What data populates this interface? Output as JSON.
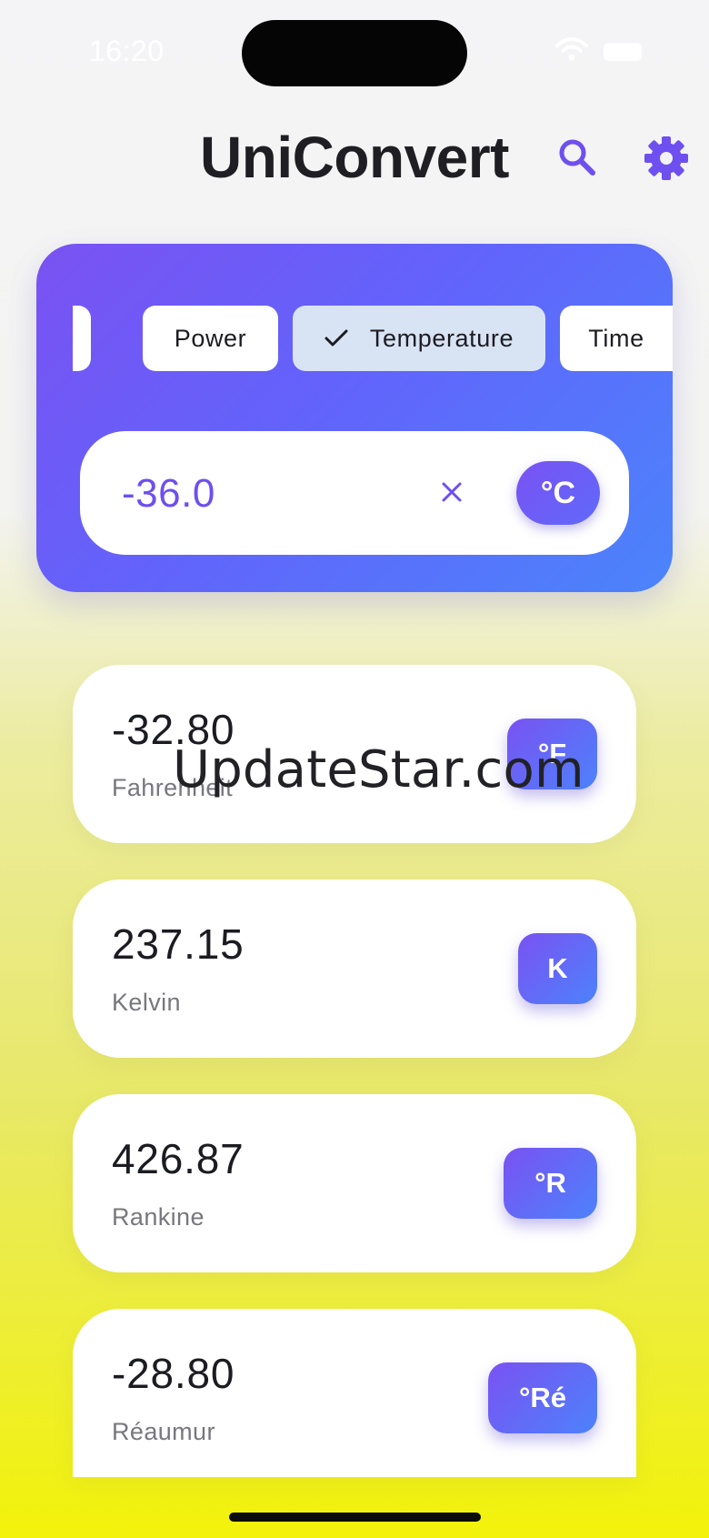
{
  "status_bar": {
    "time": "16:20"
  },
  "header": {
    "title": "UniConvert",
    "search_icon": "search-icon",
    "settings_icon": "gear-icon"
  },
  "categories": {
    "items": [
      {
        "label": "Power",
        "selected": false
      },
      {
        "label": "Temperature",
        "selected": true
      },
      {
        "label": "Time",
        "selected": false
      }
    ]
  },
  "input": {
    "value": "-36.0",
    "unit": "°C"
  },
  "results": [
    {
      "value": "-32.80",
      "name": "Fahrenheit",
      "unit": "°F"
    },
    {
      "value": "237.15",
      "name": "Kelvin",
      "unit": "K"
    },
    {
      "value": "426.87",
      "name": "Rankine",
      "unit": "°R"
    },
    {
      "value": "-28.80",
      "name": "Réaumur",
      "unit": "°Ré"
    }
  ],
  "watermark": "UpdateStar.com",
  "colors": {
    "accent": "#6e4ff0",
    "gradient_start": "#7a52f2",
    "gradient_end": "#4b84fb",
    "selected_chip": "#d8e4f4"
  }
}
